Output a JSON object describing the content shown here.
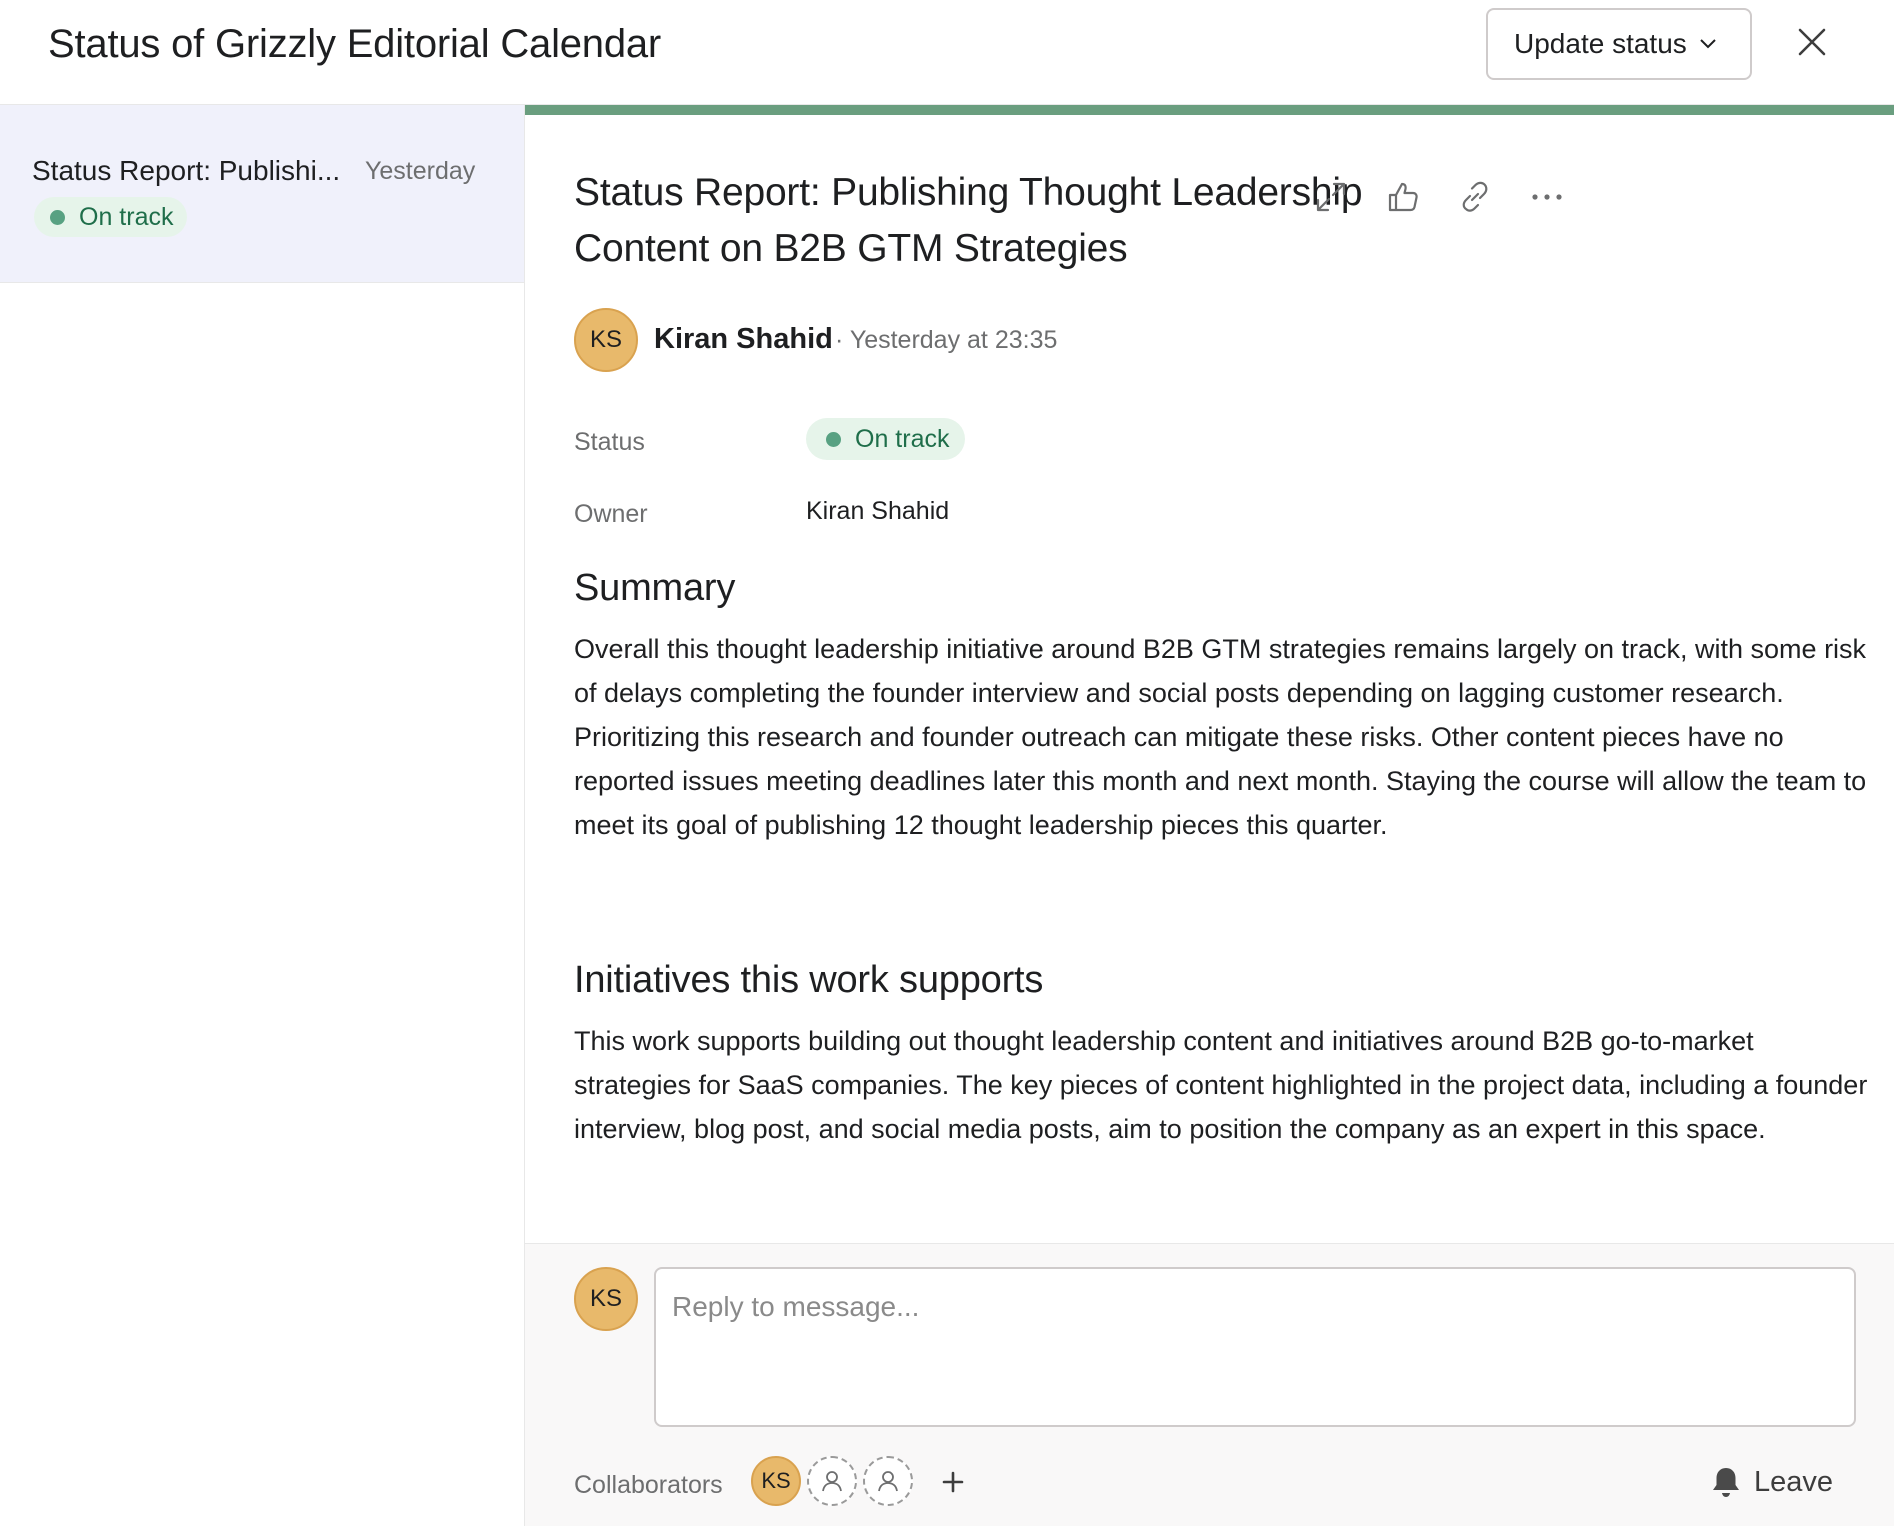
{
  "header": {
    "title": "Status of Grizzly Editorial Calendar",
    "update_status_label": "Update status"
  },
  "sidebar": {
    "items": [
      {
        "title": "Status Report: Publishi...",
        "time": "Yesterday",
        "status": "On track"
      }
    ]
  },
  "report": {
    "title": "Status Report: Publishing Thought Leadership Content on B2B GTM Strategies",
    "author": {
      "initials": "KS",
      "name": "Kiran Shahid",
      "time": "· Yesterday at 23:35"
    },
    "fields": {
      "status_label": "Status",
      "status_value": "On track",
      "owner_label": "Owner",
      "owner_value": "Kiran Shahid"
    },
    "sections": [
      {
        "heading": "Summary",
        "body": "Overall this thought leadership initiative around B2B GTM strategies remains largely on track, with some risk of delays completing the founder interview and social posts depending on lagging customer research. Prioritizing this research and founder outreach can mitigate these risks. Other content pieces have no reported issues meeting deadlines later this month and next month. Staying the course will allow the team to meet its goal of publishing 12 thought leadership pieces this quarter."
      },
      {
        "heading": "Initiatives this work supports",
        "body": "This work supports building out thought leadership content and initiatives around B2B go-to-market strategies for SaaS companies. The key pieces of content highlighted in the project data, including a founder interview, blog post, and social media posts, aim to position the company as an expert in this space."
      }
    ]
  },
  "reply": {
    "avatar_initials": "KS",
    "placeholder": "Reply to message..."
  },
  "collaborators": {
    "label": "Collaborators",
    "avatar_initials": "KS",
    "leave_label": "Leave"
  },
  "icons": {
    "close": "close-icon",
    "chevron": "chevron-down-icon",
    "expand": "expand-icon",
    "like": "thumbs-up-icon",
    "link": "link-icon",
    "more": "more-icon",
    "bell": "bell-icon",
    "add": "plus-icon",
    "person": "person-icon"
  },
  "colors": {
    "accent_bar": "#6a9e7f",
    "on_track_bg": "#e6f4ea",
    "on_track_dot": "#58a182",
    "avatar": "#e8b96b",
    "selected_item_bg": "#f0f1fb"
  }
}
